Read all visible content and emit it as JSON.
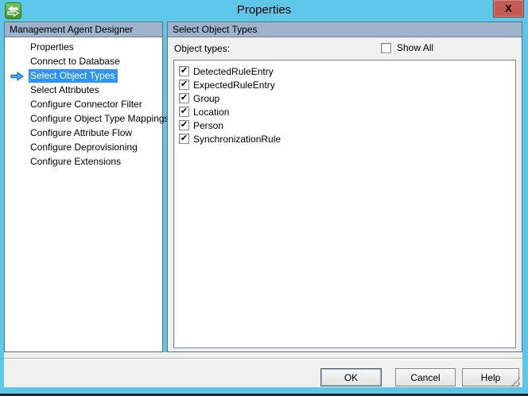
{
  "window": {
    "title": "Properties",
    "close_glyph": "X"
  },
  "icons": {
    "check": "✔"
  },
  "sidebar": {
    "header": "Management Agent Designer",
    "items": [
      {
        "label": "Properties",
        "selected": false
      },
      {
        "label": "Connect to Database",
        "selected": false
      },
      {
        "label": "Select Object Types",
        "selected": true
      },
      {
        "label": "Select Attributes",
        "selected": false
      },
      {
        "label": "Configure Connector Filter",
        "selected": false
      },
      {
        "label": "Configure Object Type Mappings",
        "selected": false
      },
      {
        "label": "Configure Attribute Flow",
        "selected": false
      },
      {
        "label": "Configure Deprovisioning",
        "selected": false
      },
      {
        "label": "Configure Extensions",
        "selected": false
      }
    ]
  },
  "main": {
    "header": "Select Object Types",
    "object_types_label": "Object types:",
    "show_all": {
      "label": "Show All",
      "checked": false
    },
    "object_types": [
      {
        "label": "DetectedRuleEntry",
        "checked": true
      },
      {
        "label": "ExpectedRuleEntry",
        "checked": true
      },
      {
        "label": "Group",
        "checked": true
      },
      {
        "label": "Location",
        "checked": true
      },
      {
        "label": "Person",
        "checked": true
      },
      {
        "label": "SynchronizationRule",
        "checked": true
      }
    ]
  },
  "footer": {
    "ok_label": "OK",
    "cancel_label": "Cancel",
    "help_label": "Help"
  },
  "colors": {
    "frame": "#5CC7E8",
    "panel_header": "#9DB3CC",
    "selection": "#3095F2",
    "close_button": "#C15B54",
    "panel_bg": "#F0F0F0",
    "bottom_strip": "#17242E"
  }
}
